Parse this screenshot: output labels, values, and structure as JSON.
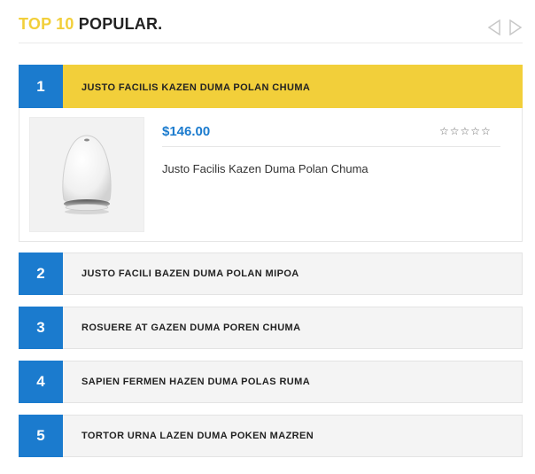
{
  "header": {
    "title_accent": "TOP 10",
    "title_rest": "POPULAR.",
    "prev_icon": "triangle-left-outline-icon",
    "next_icon": "triangle-right-outline-icon"
  },
  "colors": {
    "accent_yellow": "#f2cf3a",
    "brand_blue": "#1b7bce",
    "item_bg": "#f4f4f4"
  },
  "list": {
    "items": [
      {
        "rank": "1",
        "label": "JUSTO FACILIS KAZEN DUMA POLAN CHUMA",
        "active": true
      },
      {
        "rank": "2",
        "label": "JUSTO FACILI BAZEN DUMA POLAN MIPOA",
        "active": false
      },
      {
        "rank": "3",
        "label": "ROSUERE AT GAZEN DUMA POREN CHUMA",
        "active": false
      },
      {
        "rank": "4",
        "label": "SAPIEN FERMEN HAZEN DUMA POLAS RUMA",
        "active": false
      },
      {
        "rank": "5",
        "label": "TORTOR URNA LAZEN DUMA POKEN MAZREN",
        "active": false
      }
    ]
  },
  "detail": {
    "price": "$146.00",
    "rating": 0,
    "rating_max": 5,
    "stars_text": "☆☆☆☆☆",
    "product_name": "Justo Facilis Kazen Duma Polan Chuma",
    "image_icon": "speaker-product-image"
  }
}
